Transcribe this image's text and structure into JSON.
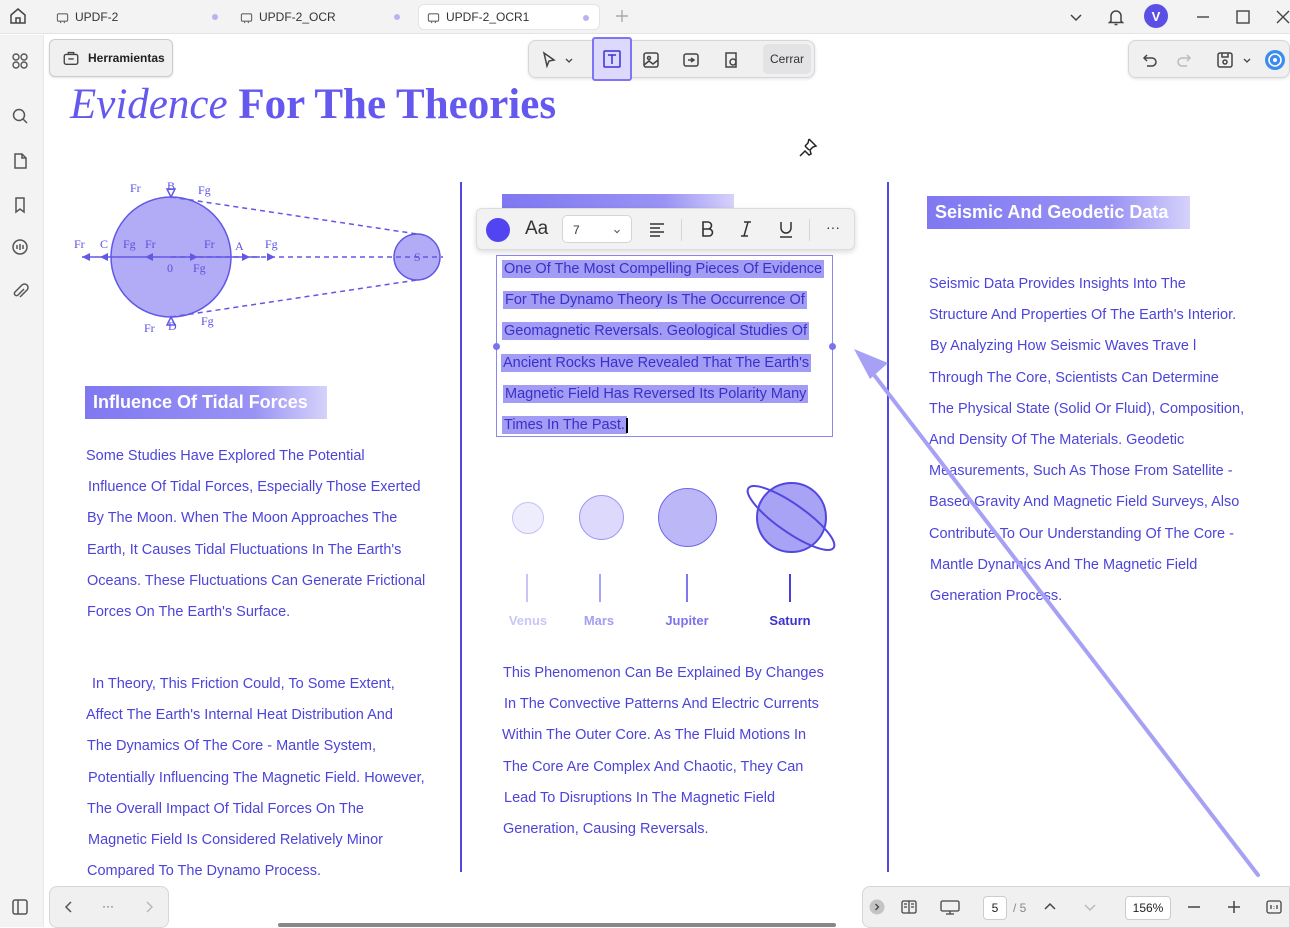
{
  "tabs": [
    {
      "label": "UPDF-2"
    },
    {
      "label": "UPDF-2_OCR"
    },
    {
      "label": "UPDF-2_OCR1"
    }
  ],
  "user": {
    "initial": "V"
  },
  "toolbar": {
    "tools_label": "Herramientas",
    "close_label": "Cerrar"
  },
  "doc": {
    "title_italic": "Evidence",
    "title_bold": "For The Theories",
    "tidal_header": "Influence Of Tidal Forces",
    "tidal_para1": [
      "Some Studies Have Explored The Potential",
      "Influence Of Tidal Forces, Especially Those Exerted",
      "By The Moon. When The Moon Approaches The",
      "Earth, It Causes Tidal Fluctuations In The Earth's",
      "Oceans. These Fluctuations Can Generate Frictional",
      "Forces On The Earth's Surface."
    ],
    "tidal_para2": [
      "In Theory, This Friction Could, To Some Extent,",
      "Affect The Earth's Internal Heat Distribution And",
      "The Dynamics Of The Core - Mantle System,",
      "Potentially Influencing The Magnetic Field. However,",
      "The Overall Impact Of Tidal Forces On The",
      "Magnetic Field Is Considered Relatively Minor",
      "Compared To The Dynamo Process."
    ],
    "selected_para": [
      "One Of The Most Compelling Pieces Of Evidence",
      "For The Dynamo Theory Is The Occurrence Of",
      "Geomagnetic Reversals. Geological Studies Of",
      "Ancient Rocks Have Revealed That The Earth's",
      "Magnetic Field Has Reversed Its Polarity Many",
      "Times In The Past."
    ],
    "planets": [
      "Venus",
      "Mars",
      "Jupiter",
      "Saturn"
    ],
    "middle_para": [
      "This Phenomenon Can Be Explained By Changes",
      "In The Convective Patterns And Electric Currents",
      "Within The Outer Core. As The Fluid Motions In",
      "The Core Are Complex And Chaotic, They Can",
      "Lead To Disruptions In The Magnetic Field",
      "Generation, Causing Reversals."
    ],
    "seismic_header": "Seismic And Geodetic Data",
    "seismic_para": [
      "Seismic Data Provides Insights Into The",
      "Structure And Properties Of The Earth's Interior.",
      "By Analyzing How Seismic Waves Trave l",
      "Through The Core, Scientists Can Determine",
      "The Physical State (Solid Or Fluid), Composition,",
      "And Density Of The Materials. Geodetic",
      "Measurements, Such As Those From Satellite -",
      "Based Gravity And Magnetic Field Surveys, Also",
      "Contribute To Our Understanding Of The Core -",
      "Mantle Dynamics And The Magnetic Field",
      "Generation Process."
    ],
    "diagram_labels": {
      "f_r": "Fr",
      "f_g": "Fg",
      "B": "B",
      "C": "C",
      "A": "A",
      "D": "D",
      "O": "0",
      "S": "S"
    }
  },
  "format_bar": {
    "aa": "Aa",
    "font_size": "7",
    "more": "···",
    "color": "#5045f0"
  },
  "pager": {
    "current": "5",
    "total": "/ 5",
    "zoom": "156%",
    "more": "···"
  },
  "colors": {
    "accent": "#6458ee",
    "text": "#4d44d9",
    "selection": "#a29cf5"
  }
}
